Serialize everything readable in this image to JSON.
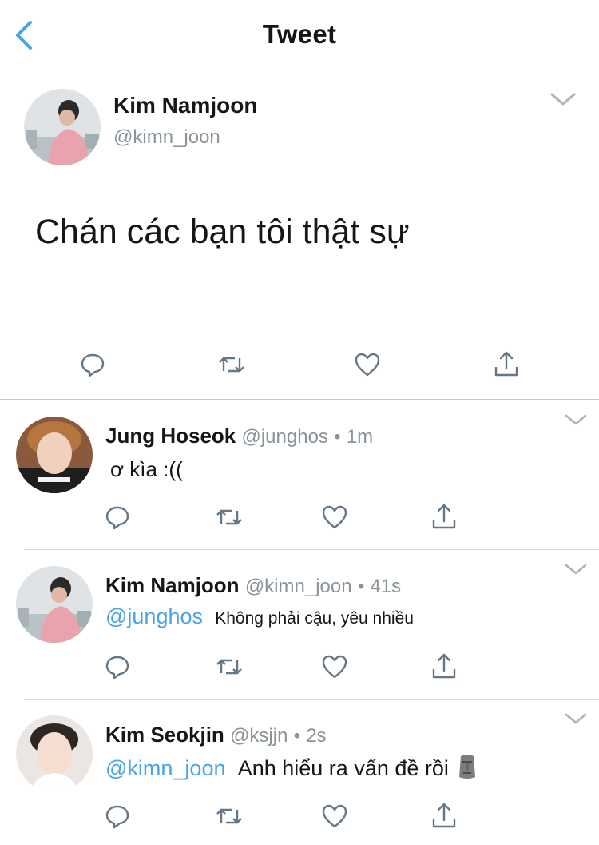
{
  "header": {
    "title": "Tweet"
  },
  "main_tweet": {
    "name": "Kim Namjoon",
    "handle": "@kimn_joon",
    "text": "Chán các bạn tôi thật sự"
  },
  "replies": [
    {
      "name": "Jung Hoseok",
      "handle": "@junghos",
      "separator": "•",
      "time": "1m",
      "text": "ơ kìa :(("
    },
    {
      "name": "Kim Namjoon",
      "handle": "@kimn_joon",
      "separator": "•",
      "time": "41s",
      "mention": "@junghos",
      "text": "Không phải cậu, yêu nhiều"
    },
    {
      "name": "Kim Seokjin",
      "handle": "@ksjjn",
      "separator": "•",
      "time": "2s",
      "mention": "@kimn_joon",
      "text": "Anh hiểu ra vấn đề rồi",
      "emoji": "moai"
    }
  ],
  "colors": {
    "accent": "#4aa3e6",
    "secondary_text": "#8a9399",
    "icon": "#657786",
    "divider": "#d5d9dd"
  },
  "icons": [
    "back-chevron-icon",
    "chevron-down-icon",
    "reply-icon",
    "retweet-icon",
    "like-icon",
    "share-icon",
    "moai-emoji"
  ]
}
